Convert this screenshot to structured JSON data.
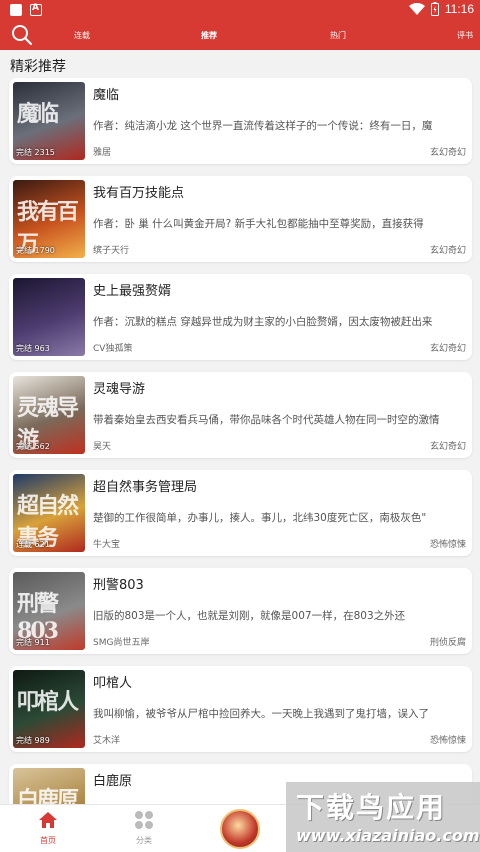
{
  "status_bar": {
    "time": "11:16"
  },
  "nav": {
    "tabs": [
      {
        "label": "连载",
        "active": false
      },
      {
        "label": "推荐",
        "active": true
      },
      {
        "label": "热门",
        "active": false
      },
      {
        "label": "评书",
        "active": false
      }
    ]
  },
  "section_title": "精彩推荐",
  "books": [
    {
      "title": "魔临",
      "description": "作者：纯洁滴小龙 这个世界一直流传着这样子的一个传说：终有一日，魔",
      "author": "雅居",
      "genre": "玄幻奇幻",
      "badge": "完结 2315",
      "cover_text": "魔临",
      "cover_colors": [
        "#2b2f3a",
        "#6b6f7a",
        "#b0281f"
      ]
    },
    {
      "title": "我有百万技能点",
      "description": "作者：卧 巢 什么叫黄金开局? 新手大礼包都能抽中至尊奖励，直接获得",
      "author": "缤子天行",
      "genre": "玄幻奇幻",
      "badge": "完结 1790",
      "cover_text": "我有百万",
      "cover_colors": [
        "#3a1a12",
        "#c8531f",
        "#f3b04a"
      ]
    },
    {
      "title": "史上最强赘婿",
      "description": "作者：沉默的糕点 穿越异世成为财主家的小白脸赘婿，因太废物被赶出来",
      "author": "CV独孤策",
      "genre": "玄幻奇幻",
      "badge": "完结 963",
      "cover_text": "",
      "cover_colors": [
        "#1b1630",
        "#4d3c70",
        "#8a7aa8"
      ]
    },
    {
      "title": "灵魂导游",
      "description": "带着秦始皇去西安看兵马俑，带你品味各个时代英雄人物在同一时空的激情",
      "author": "昊天",
      "genre": "玄幻奇幻",
      "badge": "完结 562",
      "cover_text": "灵魂导游",
      "cover_colors": [
        "#e8e4dc",
        "#7a6a5a",
        "#c0301f"
      ]
    },
    {
      "title": "超自然事务管理局",
      "description": "楚御的工作很简单，办事儿，揍人。事儿，北纬30度死亡区，南极灰色\"",
      "author": "牛大宝",
      "genre": "恐怖惊悚",
      "badge": "连载 621",
      "cover_text": "超自然事务",
      "cover_colors": [
        "#1e3a6a",
        "#d8a23a",
        "#b0281f"
      ]
    },
    {
      "title": "刑警803",
      "description": "旧版的803是一个人，也就是刘刚，就像是007一样，在803之外还",
      "author": "SMG尚世五岸",
      "genre": "刑侦反腐",
      "badge": "完结 911",
      "cover_text": "刑警803",
      "cover_colors": [
        "#5a5a5a",
        "#8a8a8a",
        "#c03a2a"
      ]
    },
    {
      "title": "叩棺人",
      "description": "我叫柳愉，被爷爷从尸棺中捡回养大。一天晚上我遇到了鬼打墙，误入了",
      "author": "艾木洋",
      "genre": "恐怖惊悚",
      "badge": "完结 989",
      "cover_text": "叩棺人",
      "cover_colors": [
        "#0f1a14",
        "#2c4a36",
        "#b0281f"
      ]
    },
    {
      "title": "白鹿原",
      "description": "",
      "author": "",
      "genre": "",
      "badge": "",
      "cover_text": "白鹿原",
      "cover_colors": [
        "#d8c49a",
        "#b08a4a",
        "#7a5a2a"
      ]
    }
  ],
  "tabbar": {
    "items": [
      {
        "label": "首页",
        "icon": "home-icon",
        "active": true
      },
      {
        "label": "分类",
        "icon": "category-icon",
        "active": false
      }
    ]
  },
  "watermark": {
    "line1": "下载鸟应用",
    "line2": "www.xiazainiao.com"
  },
  "colors": {
    "brand": "#d63a33"
  }
}
